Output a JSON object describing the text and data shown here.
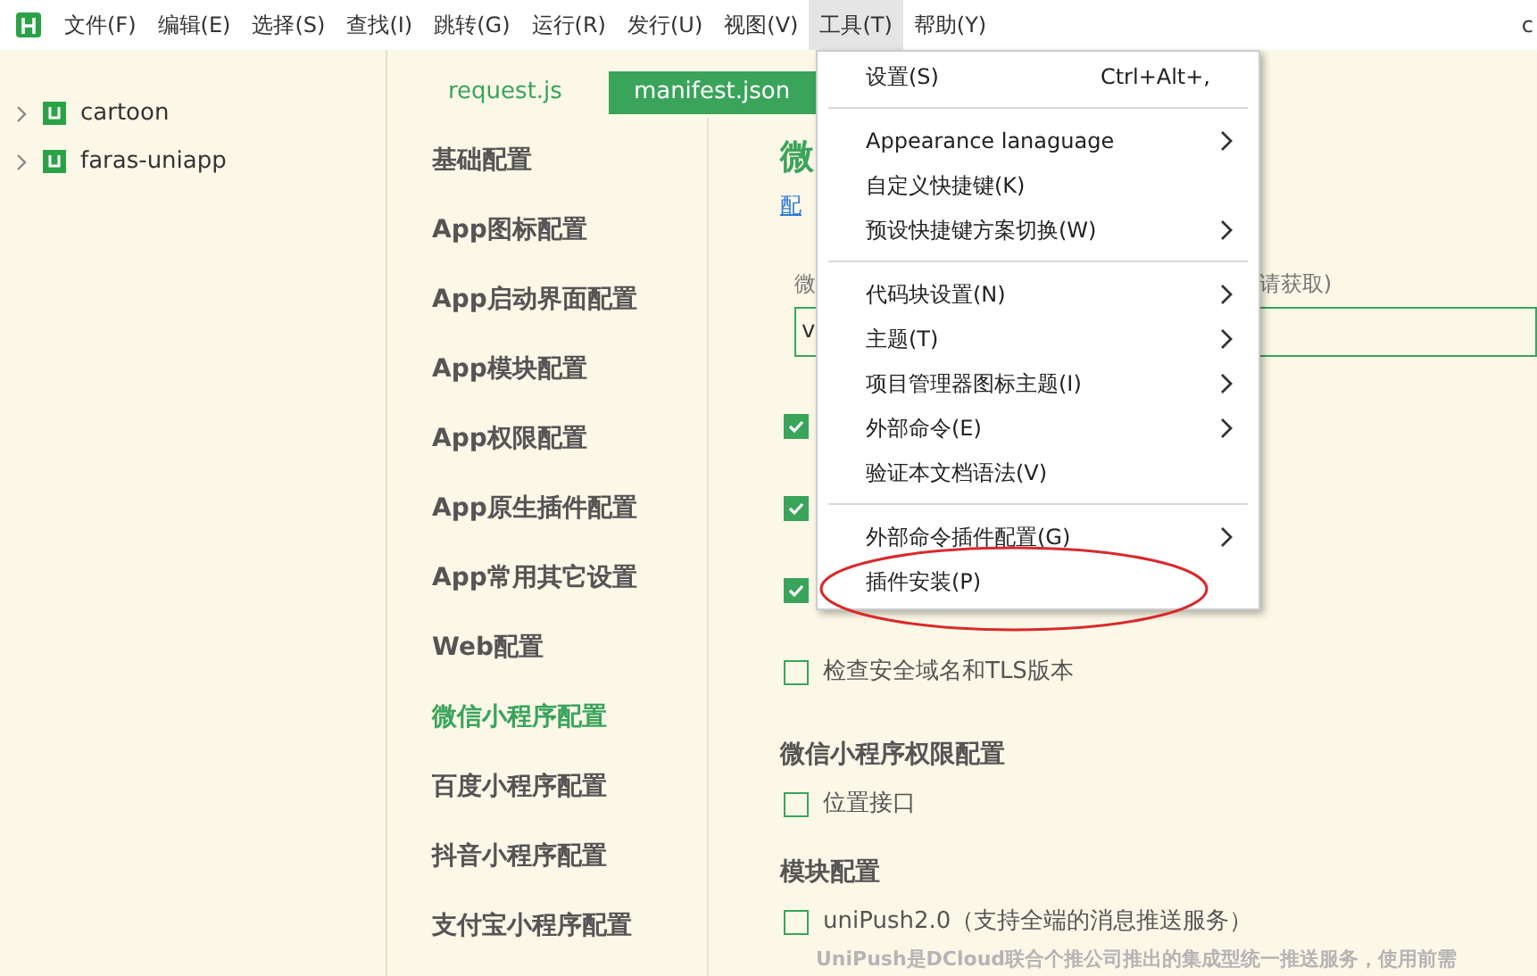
{
  "menubar": {
    "items": [
      {
        "label": "文件(F)",
        "selected": false
      },
      {
        "label": "编辑(E)",
        "selected": false
      },
      {
        "label": "选择(S)",
        "selected": false
      },
      {
        "label": "查找(I)",
        "selected": false
      },
      {
        "label": "跳转(G)",
        "selected": false
      },
      {
        "label": "运行(R)",
        "selected": false
      },
      {
        "label": "发行(U)",
        "selected": false
      },
      {
        "label": "视图(V)",
        "selected": false
      },
      {
        "label": "工具(T)",
        "selected": true
      },
      {
        "label": "帮助(Y)",
        "selected": false
      }
    ],
    "title": "c"
  },
  "sidebar": {
    "projects": [
      {
        "name": "cartoon",
        "expanded": false
      },
      {
        "name": "faras-uniapp",
        "expanded": false
      }
    ]
  },
  "editor_tabs": [
    {
      "label": "request.js",
      "selected": false
    },
    {
      "label": "manifest.json",
      "selected": true
    }
  ],
  "nav": [
    {
      "label": "基础配置",
      "selected": false
    },
    {
      "label": "App图标配置",
      "selected": false
    },
    {
      "label": "App启动界面配置",
      "selected": false
    },
    {
      "label": "App模块配置",
      "selected": false
    },
    {
      "label": "App权限配置",
      "selected": false
    },
    {
      "label": "App原生插件配置",
      "selected": false
    },
    {
      "label": "App常用其它设置",
      "selected": false
    },
    {
      "label": "Web配置",
      "selected": false
    },
    {
      "label": "微信小程序配置",
      "selected": true
    },
    {
      "label": "百度小程序配置",
      "selected": false
    },
    {
      "label": "抖音小程序配置",
      "selected": false
    },
    {
      "label": "支付宝小程序配置",
      "selected": false
    }
  ],
  "content": {
    "heading": "微",
    "link": "配",
    "field_label": "微",
    "field_label_end": "请获取)",
    "field_value": "v",
    "groups": [
      {
        "options": [
          {
            "checked": true
          },
          {
            "checked": true
          },
          {
            "checked": true
          },
          {
            "label": "检查安全域名和TLS版本",
            "checked": false
          }
        ]
      },
      {
        "title": "微信小程序权限配置",
        "options": [
          {
            "label": "位置接口",
            "checked": false
          }
        ]
      },
      {
        "title": "模块配置",
        "options": [
          {
            "label": "uniPush2.0（支持全端的消息推送服务）",
            "checked": false
          }
        ]
      }
    ],
    "note": "UniPush是DCloud联合个推公司推出的集成型统一推送服务，使用前需"
  },
  "menu": {
    "items": [
      {
        "kind": "item",
        "label": "设置(S)",
        "shortcut": "Ctrl+Alt+,",
        "submenu": false
      },
      {
        "kind": "separator"
      },
      {
        "kind": "item",
        "label": "Appearance lanaguage",
        "submenu": true
      },
      {
        "kind": "item",
        "label": "自定义快捷键(K)",
        "submenu": false
      },
      {
        "kind": "item",
        "label": "预设快捷键方案切换(W)",
        "submenu": true
      },
      {
        "kind": "separator"
      },
      {
        "kind": "item",
        "label": "代码块设置(N)",
        "submenu": true
      },
      {
        "kind": "item",
        "label": "主题(T)",
        "submenu": true
      },
      {
        "kind": "item",
        "label": "项目管理器图标主题(I)",
        "submenu": true
      },
      {
        "kind": "item",
        "label": "外部命令(E)",
        "submenu": true
      },
      {
        "kind": "item",
        "label": "验证本文档语法(V)",
        "submenu": false
      },
      {
        "kind": "separator"
      },
      {
        "kind": "item",
        "label": "外部命令插件配置(G)",
        "submenu": true
      },
      {
        "kind": "item",
        "label": "插件安装(P)",
        "submenu": false
      }
    ]
  }
}
